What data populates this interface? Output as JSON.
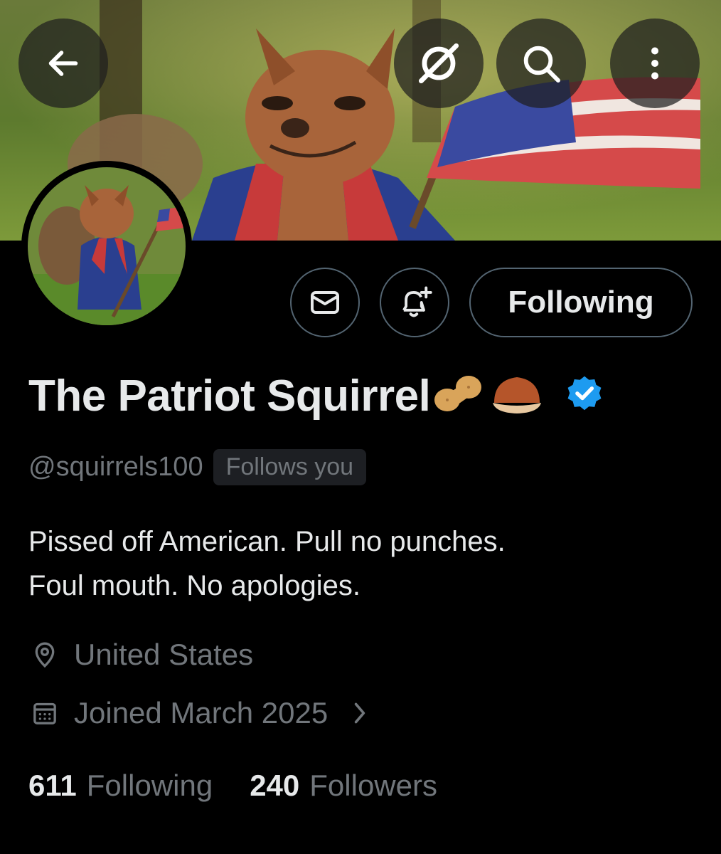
{
  "profile": {
    "display_name": "The Patriot Squirrel",
    "name_emojis": "🥜🌰",
    "handle": "@squirrels100",
    "follows_you_badge": "Follows you",
    "bio_lines": [
      "Pissed off American.  Pull no punches.",
      "Foul mouth.  No apologies."
    ],
    "location": "United States",
    "joined": "Joined March 2025",
    "following_count": "611",
    "following_label": "Following",
    "followers_count": "240",
    "followers_label": "Followers"
  },
  "actions": {
    "following_button": "Following"
  },
  "colors": {
    "background": "#000000",
    "primary_text": "#e7e9ea",
    "secondary_text": "#71767b",
    "border": "#536471",
    "verified": "#1d9bf0"
  },
  "icons": [
    "back-arrow-icon",
    "grok-icon",
    "search-icon",
    "more-vertical-icon",
    "mail-icon",
    "bell-plus-icon",
    "verified-badge-icon",
    "location-pin-icon",
    "calendar-icon",
    "chevron-right-icon"
  ]
}
